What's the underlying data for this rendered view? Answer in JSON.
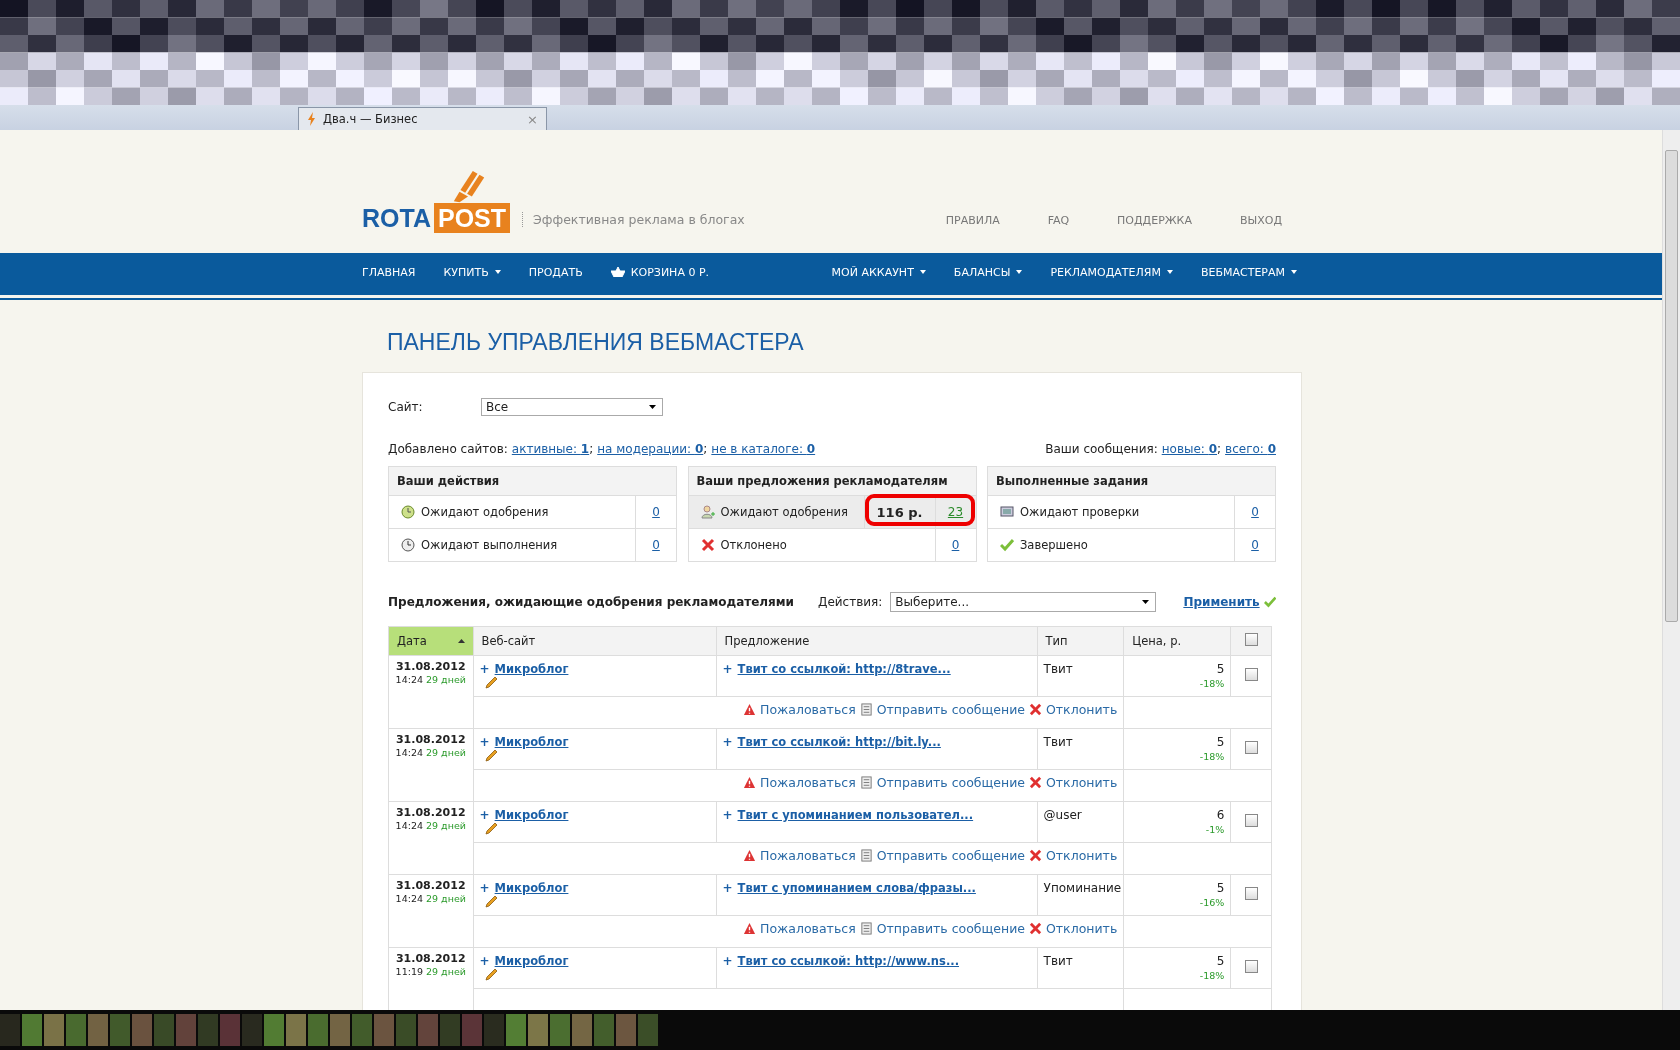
{
  "browser_tab": {
    "title": "Два.ч — Бизнес",
    "close": "×"
  },
  "header": {
    "logo_left": "ROTA",
    "logo_right": "POST",
    "tagline": "Эффективная реклама в блогах",
    "links": [
      "ПРАВИЛА",
      "FAQ",
      "ПОДДЕРЖКА",
      "ВЫХОД"
    ]
  },
  "nav": {
    "left": [
      {
        "label": "ГЛАВНАЯ",
        "has_menu": false,
        "kind": "link"
      },
      {
        "label": "КУПИТЬ",
        "has_menu": true,
        "kind": "link"
      },
      {
        "label": "ПРОДАТЬ",
        "has_menu": false,
        "kind": "link"
      },
      {
        "label": "КОРЗИНА 0 Р.",
        "has_menu": false,
        "kind": "cart"
      }
    ],
    "right": [
      {
        "label": "МОЙ АККАУНТ",
        "has_menu": true,
        "kind": "link"
      },
      {
        "label": "БАЛАНСЫ",
        "has_menu": true,
        "kind": "link"
      },
      {
        "label": "РЕКЛАМОДАТЕЛЯМ",
        "has_menu": true,
        "kind": "link"
      },
      {
        "label": "ВЕБМАСТЕРАМ",
        "has_menu": true,
        "kind": "link"
      }
    ]
  },
  "page_title": "ПАНЕЛЬ УПРАВЛЕНИЯ ВЕБМАСТЕРА",
  "site_filter": {
    "label": "Сайт:",
    "value": "Все"
  },
  "sites_summary": {
    "label": "Добавлено сайтов:",
    "links": [
      {
        "text": "активные: ",
        "count": "1",
        "sep": ";"
      },
      {
        "text": "на модерации: ",
        "count": "0",
        "sep": ";"
      },
      {
        "text": "не в каталоге: ",
        "count": "0"
      }
    ]
  },
  "messages_summary": {
    "label": "Ваши сообщения:",
    "links": [
      {
        "text": "новые: ",
        "count": "0",
        "sep": ";"
      },
      {
        "text": "всего: ",
        "count": "0"
      }
    ]
  },
  "stat_boxes": [
    {
      "title": "Ваши действия",
      "rows": [
        {
          "kind": "pending",
          "label": "Ожидают одобрения",
          "count": "0"
        },
        {
          "kind": "waiting",
          "label": "Ожидают выполнения",
          "count": "0"
        }
      ]
    },
    {
      "title": "Ваши предложения рекламодателям",
      "rows": [
        {
          "kind": "offer",
          "label": "Ожидают одобрения",
          "amount": "116 р.",
          "count": "23",
          "highlighted": true
        },
        {
          "kind": "rejected",
          "label": "Отклонено",
          "count": "0",
          "highlighted": false
        }
      ]
    },
    {
      "title": "Выполненные задания",
      "rows": [
        {
          "kind": "review",
          "label": "Ожидают проверки",
          "count": "0"
        },
        {
          "kind": "done",
          "label": "Завершено",
          "count": "0"
        }
      ]
    }
  ],
  "offers": {
    "title": "Предложения, ожидающие одобрения рекламодателями",
    "actions_label": "Действия:",
    "actions_value": "Выберите...",
    "apply": "Применить",
    "columns": [
      {
        "label": "Дата",
        "sorted": true
      },
      {
        "label": "Веб-сайт",
        "sorted": false
      },
      {
        "label": "Предложение",
        "sorted": false
      },
      {
        "label": "Тип",
        "sorted": false
      },
      {
        "label": "Цена, р.",
        "sorted": false
      }
    ],
    "rows": [
      {
        "date": "31.08.2012",
        "time": "14:24",
        "age": "29 дней",
        "site_prefix": "+",
        "site": "Микроблог",
        "offer_prefix": "+",
        "offer": "Твит со ссылкой: http://8trave...",
        "type": "Твит",
        "price": "5",
        "discount": "-18%",
        "checked": false,
        "actions": [
          "Пожаловаться",
          "Отправить сообщение",
          "Отклонить"
        ]
      },
      {
        "date": "31.08.2012",
        "time": "14:24",
        "age": "29 дней",
        "site_prefix": "+",
        "site": "Микроблог",
        "offer_prefix": "+",
        "offer": "Твит со ссылкой: http://bit.ly...",
        "type": "Твит",
        "price": "5",
        "discount": "-18%",
        "checked": false,
        "actions": [
          "Пожаловаться",
          "Отправить сообщение",
          "Отклонить"
        ]
      },
      {
        "date": "31.08.2012",
        "time": "14:24",
        "age": "29 дней",
        "site_prefix": "+",
        "site": "Микроблог",
        "offer_prefix": "+",
        "offer": "Твит с упоминанием пользовател...",
        "type": "@user",
        "price": "6",
        "discount": "-1%",
        "checked": false,
        "actions": [
          "Пожаловаться",
          "Отправить сообщение",
          "Отклонить"
        ]
      },
      {
        "date": "31.08.2012",
        "time": "14:24",
        "age": "29 дней",
        "site_prefix": "+",
        "site": "Микроблог",
        "offer_prefix": "+",
        "offer": "Твит с упоминанием слова/фразы...",
        "type": "Упоминание",
        "price": "5",
        "discount": "-16%",
        "checked": false,
        "actions": [
          "Пожаловаться",
          "Отправить сообщение",
          "Отклонить"
        ]
      },
      {
        "date": "31.08.2012",
        "time": "11:19",
        "age": "29 дней",
        "site_prefix": "+",
        "site": "Микроблог",
        "offer_prefix": "+",
        "offer": "Твит со ссылкой: http://www.ns...",
        "type": "Твит",
        "price": "5",
        "discount": "-18%",
        "checked": false
      }
    ],
    "select_all_checked": false
  }
}
